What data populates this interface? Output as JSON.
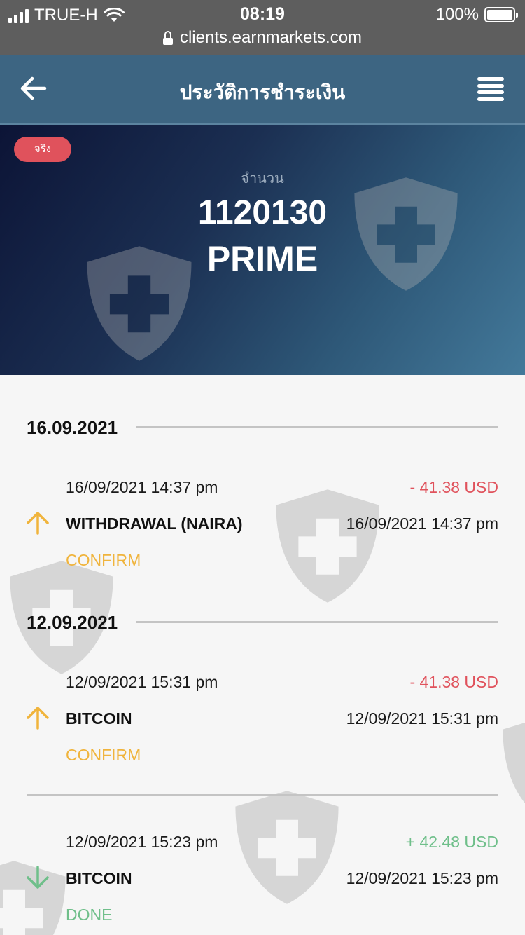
{
  "status_bar": {
    "carrier": "TRUE-H",
    "time": "08:19",
    "battery": "100%",
    "url": "clients.earnmarkets.com"
  },
  "header": {
    "title": "ประวัติการชำระเงิน",
    "back_icon": "arrow-left-icon",
    "menu_icon": "menu-icon"
  },
  "account": {
    "badge": "จริง",
    "amount_label": "จำนวน",
    "account_number": "1120130",
    "account_type": "PRIME"
  },
  "groups": [
    {
      "date": "16.09.2021",
      "transactions": [
        {
          "datetime": "16/09/2021 14:37 pm",
          "amount": "- 41.38 USD",
          "direction": "out",
          "method": "WITHDRAWAL (NAIRA)",
          "datetime_secondary": "16/09/2021 14:37 pm",
          "status": "CONFIRM"
        }
      ]
    },
    {
      "date": "12.09.2021",
      "transactions": [
        {
          "datetime": "12/09/2021 15:31 pm",
          "amount": "- 41.38 USD",
          "direction": "out",
          "method": "BITCOIN",
          "datetime_secondary": "12/09/2021 15:31 pm",
          "status": "CONFIRM"
        },
        {
          "datetime": "12/09/2021 15:23 pm",
          "amount": "+ 42.48 USD",
          "direction": "in",
          "method": "BITCOIN",
          "datetime_secondary": "12/09/2021 15:23 pm",
          "status": "DONE"
        }
      ]
    }
  ],
  "colors": {
    "negative": "#e0525c",
    "positive": "#6fbf8a",
    "confirm": "#f0b43c",
    "done": "#6fbf8a",
    "header_bg": "#3d6582",
    "badge_bg": "#e0525c"
  }
}
